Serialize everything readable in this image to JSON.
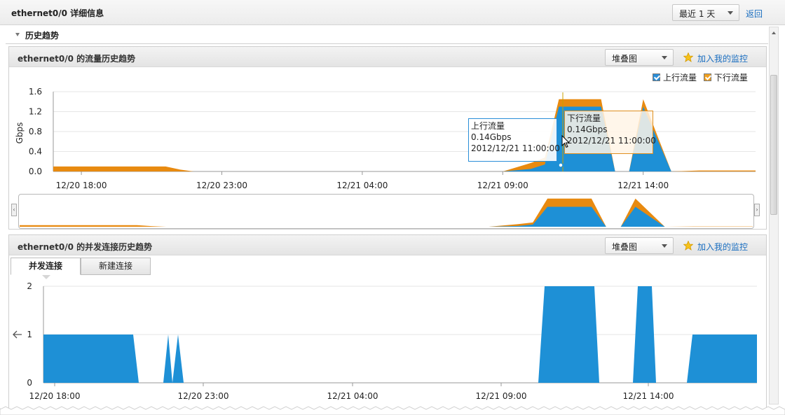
{
  "header": {
    "title": "ethernet0/0 详细信息",
    "range_select": "最近 1 天",
    "back_link": "返回"
  },
  "section": {
    "label": "历史趋势"
  },
  "traffic_panel": {
    "title": "ethernet0/0 的流量历史趋势",
    "chart_type_select": "堆叠图",
    "add_monitor": "加入我的监控",
    "legend": [
      "上行流量",
      "下行流量"
    ],
    "tooltip_up": {
      "name": "上行流量",
      "value": "0.14Gbps",
      "time": "2012/12/21 11:00:00"
    },
    "tooltip_down": {
      "name": "下行流量",
      "value": "0.14Gbps",
      "time": "2012/12/21 11:00:00"
    }
  },
  "conn_panel": {
    "title": "ethernet0/0 的并发连接历史趋势",
    "chart_type_select": "堆叠图",
    "add_monitor": "加入我的监控",
    "tabs": [
      "并发连接",
      "新建连接"
    ]
  },
  "colors": {
    "up": "#1e90d6",
    "down": "#e88a10",
    "link": "#1a6ec0"
  },
  "chart_data": [
    {
      "type": "area",
      "ylabel": "Gbps",
      "ylim": [
        0,
        1.6
      ],
      "yticks": [
        "0.0",
        "0.4",
        "0.8",
        "1.2",
        "1.6"
      ],
      "xticks": [
        "12/20 18:00",
        "12/20 23:00",
        "12/21 04:00",
        "12/21 09:00",
        "12/21 14:00"
      ],
      "x_hours": [
        0,
        3,
        4,
        4.5,
        5,
        5.5,
        6,
        9,
        10,
        12,
        16,
        17,
        17.5,
        18,
        19,
        19.5,
        20,
        20.5,
        21,
        22,
        23,
        24,
        25
      ],
      "series": [
        {
          "name": "上行流量",
          "values": [
            0,
            0,
            0,
            0,
            0,
            0,
            0,
            0,
            0,
            0,
            0,
            0.05,
            0.14,
            1.3,
            1.3,
            1.3,
            0,
            0,
            1.3,
            0,
            0,
            0,
            0
          ]
        },
        {
          "name": "下行流量",
          "values": [
            0.1,
            0.1,
            0.1,
            0.04,
            0,
            0,
            0,
            0,
            0,
            0,
            0,
            0.12,
            0.14,
            0.15,
            0.15,
            0.15,
            0,
            0,
            0.15,
            0,
            0.02,
            0.02,
            0.02
          ]
        }
      ]
    },
    {
      "type": "area",
      "ylim": [
        0,
        2
      ],
      "yticks": [
        "0",
        "1",
        "2"
      ],
      "xticks": [
        "12/20 18:00",
        "12/20 23:00",
        "12/21 04:00",
        "12/21 09:00",
        "12/21 14:00"
      ],
      "series": [
        {
          "name": "并发连接",
          "values": [
            1,
            1,
            1,
            0,
            1,
            0,
            1,
            0,
            0,
            0,
            2,
            2,
            0,
            2,
            0,
            1,
            1
          ]
        }
      ]
    }
  ]
}
